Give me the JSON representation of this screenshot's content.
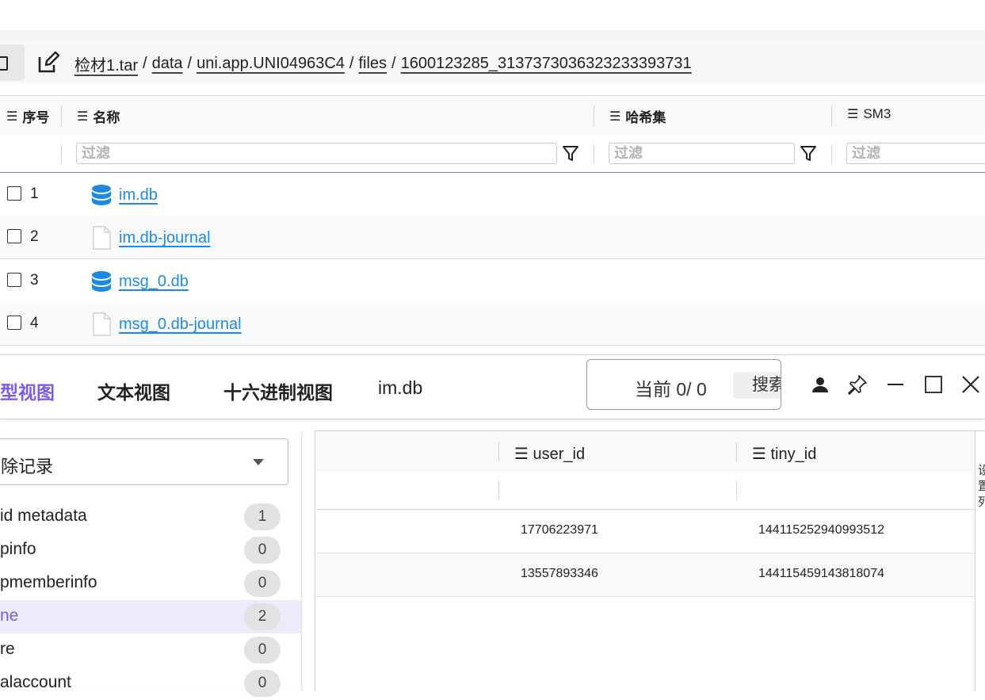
{
  "toolbar": {
    "breadcrumb": [
      "检材1.tar",
      "data",
      "uni.app.UNI04963C4",
      "files",
      "1600123285_3137373036323233393731"
    ]
  },
  "file_table": {
    "columns": [
      "序号",
      "名称",
      "哈希集",
      "SM3"
    ],
    "filter_placeholder": "过滤",
    "rows": [
      {
        "index": "1",
        "name": "im.db",
        "icon": "database-icon"
      },
      {
        "index": "2",
        "name": "im.db-journal",
        "icon": "file-icon"
      },
      {
        "index": "3",
        "name": "msg_0.db",
        "icon": "database-icon"
      },
      {
        "index": "4",
        "name": "msg_0.db-journal",
        "icon": "file-icon"
      }
    ]
  },
  "viewer": {
    "tabs": [
      "型视图",
      "文本视图",
      "十六进制视图"
    ],
    "active_tab": 0,
    "title": "im.db",
    "search_status": "当前  0/  0",
    "search_button": "搜索"
  },
  "left_list": {
    "select_value": "除记录",
    "items": [
      {
        "label": "id  metadata",
        "count": "1"
      },
      {
        "label": "pinfo",
        "count": "0"
      },
      {
        "label": "pmemberinfo",
        "count": "0"
      },
      {
        "label": "ne",
        "count": "2",
        "active": true
      },
      {
        "label": "re",
        "count": "0"
      },
      {
        "label": "alaccount",
        "count": "0"
      }
    ]
  },
  "data_grid": {
    "columns": [
      "user_id",
      "tiny_id"
    ],
    "rows": [
      {
        "user_id": "17706223971",
        "tiny_id": "144115252940993512"
      },
      {
        "user_id": "13557893346",
        "tiny_id": "144115459143818074"
      }
    ],
    "side_text": "设置列"
  },
  "colors": {
    "accent": "#7c5ce6",
    "link": "#1f8be0",
    "db_icon": "#1e88e5"
  }
}
